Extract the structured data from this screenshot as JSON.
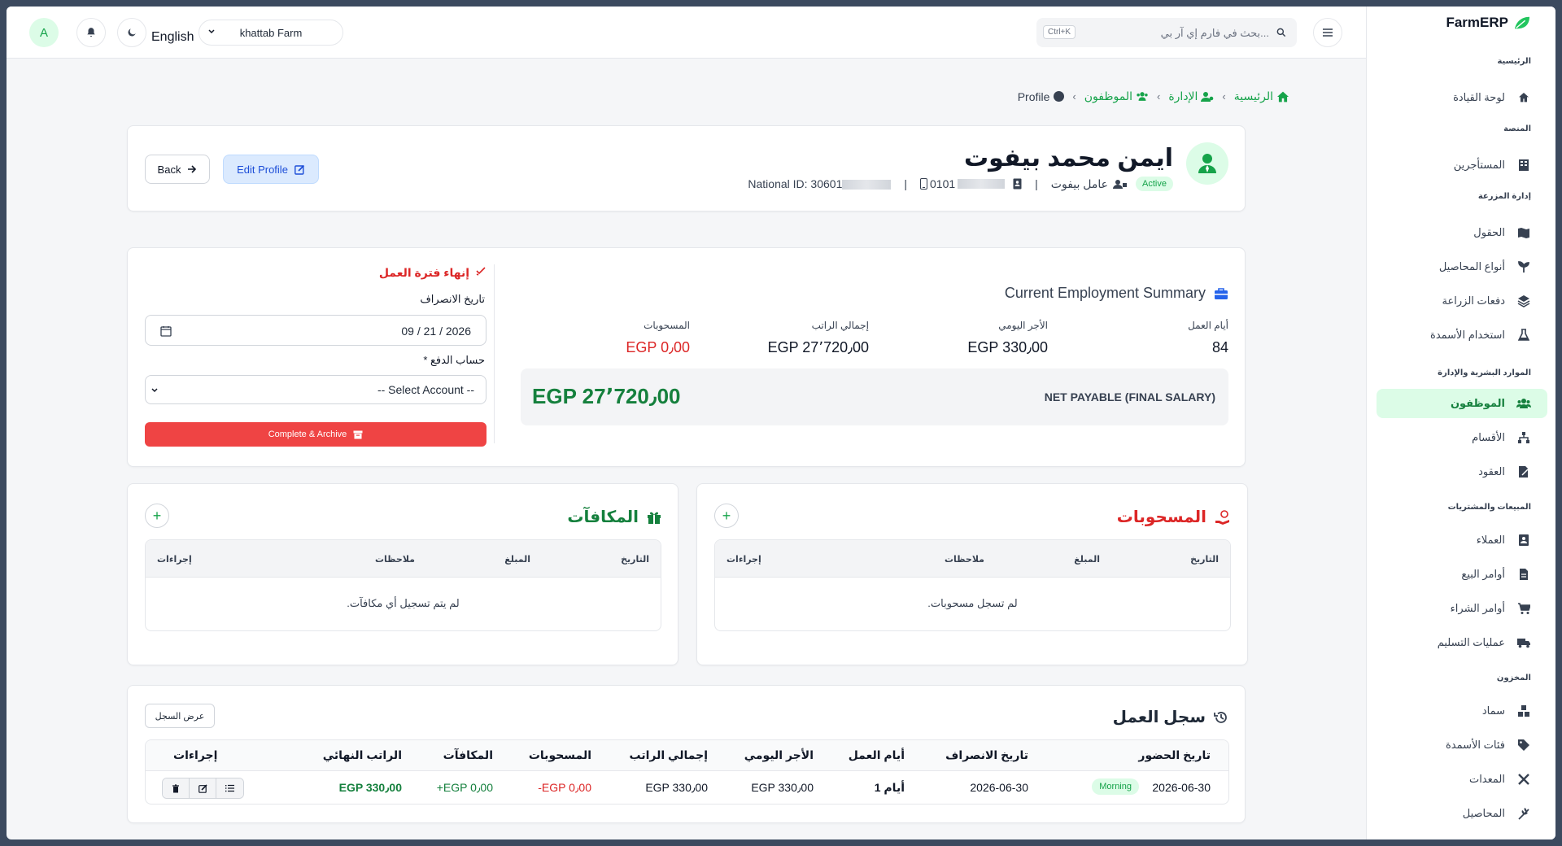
{
  "header": {
    "avatar_initial": "A",
    "language": "English",
    "farm": "khattab Farm",
    "search_placeholder": "بحث في فارم إي آر بي...",
    "search_shortcut": "Ctrl+K"
  },
  "sidebar": {
    "brand": "FarmERP",
    "sections": [
      {
        "title": "الرئيسية",
        "items": [
          {
            "label": "لوحة القيادة",
            "icon": "home-icon"
          }
        ]
      },
      {
        "title": "المنصة",
        "items": [
          {
            "label": "المستأجرين",
            "icon": "building-icon"
          }
        ]
      },
      {
        "title": "إدارة المزرعة",
        "items": [
          {
            "label": "الحقول",
            "icon": "map-icon"
          },
          {
            "label": "أنواع المحاصيل",
            "icon": "seedling-icon"
          },
          {
            "label": "دفعات الزراعة",
            "icon": "layers-icon"
          },
          {
            "label": "استخدام الأسمدة",
            "icon": "flask-icon"
          }
        ]
      },
      {
        "title": "الموارد البشرية والإدارة",
        "items": [
          {
            "label": "الموظفون",
            "icon": "users-icon",
            "active": true
          },
          {
            "label": "الأقسام",
            "icon": "sitemap-icon"
          },
          {
            "label": "العقود",
            "icon": "contract-icon"
          }
        ]
      },
      {
        "title": "المبيعات والمشتريات",
        "items": [
          {
            "label": "العملاء",
            "icon": "contact-icon"
          },
          {
            "label": "أوامر البيع",
            "icon": "invoice-icon"
          },
          {
            "label": "أوامر الشراء",
            "icon": "cart-icon"
          },
          {
            "label": "عمليات التسليم",
            "icon": "truck-icon"
          }
        ]
      },
      {
        "title": "المخزون",
        "items": [
          {
            "label": "سماد",
            "icon": "boxes-icon"
          },
          {
            "label": "فئات الأسمدة",
            "icon": "tags-icon"
          },
          {
            "label": "المعدات",
            "icon": "tools-icon"
          },
          {
            "label": "المحاصيل",
            "icon": "wheat-icon"
          }
        ]
      }
    ]
  },
  "breadcrumb": {
    "home": "الرئيسية",
    "admin": "الإدارة",
    "employees": "الموظفون",
    "current": "Profile"
  },
  "profile": {
    "name": "ايمن محمد بيفوت",
    "status": "Active",
    "role": "عامل بيفوت",
    "phone_prefix": "0101",
    "national_id_label": "National ID: 30601",
    "back_label": "Back",
    "edit_label": "Edit Profile"
  },
  "employment": {
    "title": "Current Employment Summary",
    "days_label": "أيام العمل",
    "days_value": "84",
    "daily_label": "الأجر اليومي",
    "daily_value": "EGP 330٫00",
    "total_label": "إجمالي الراتب",
    "total_value": "EGP 27٬720٫00",
    "withdrawals_label": "المسحوبات",
    "withdrawals_value": "EGP 0٫00",
    "net_label": "NET PAYABLE (FINAL SALARY)",
    "net_value": "EGP 27٬720٫00",
    "end_title": "إنهاء فترة العمل",
    "departure_label": "تاريخ الانصراف",
    "departure_value": "09 / 21 / 2026",
    "account_label": "حساب الدفع *",
    "account_value": "-- Select Account --",
    "archive_label": "Complete & Archive"
  },
  "withdrawals": {
    "title": "المسحوبات",
    "columns": [
      "التاريخ",
      "المبلغ",
      "ملاحظات",
      "إجراءات"
    ],
    "empty": "لم تسجل مسحوبات."
  },
  "rewards": {
    "title": "المكافآت",
    "columns": [
      "التاريخ",
      "المبلغ",
      "ملاحظات",
      "إجراءات"
    ],
    "empty": "لم يتم تسجيل أي مكافآت."
  },
  "worklog": {
    "title": "سجل العمل",
    "view_label": "عرض السجل",
    "columns": [
      "تاريخ الحضور",
      "تاريخ الانصراف",
      "أيام العمل",
      "الأجر اليومي",
      "إجمالي الراتب",
      "المسحوبات",
      "المكافآت",
      "الراتب النهائي",
      "إجراءات"
    ],
    "rows": [
      {
        "attendance": "2026-06-30",
        "shift": "Morning",
        "departure": "2026-06-30",
        "days": "1 أيام",
        "daily": "EGP 330٫00",
        "total": "EGP 330٫00",
        "withdrawals": "-EGP 0٫00",
        "rewards": "+EGP 0٫00",
        "final": "EGP 330٫00"
      }
    ]
  },
  "colors": {
    "accent": "#16a34a",
    "danger": "#dc2626",
    "info": "#1d4ed8"
  }
}
